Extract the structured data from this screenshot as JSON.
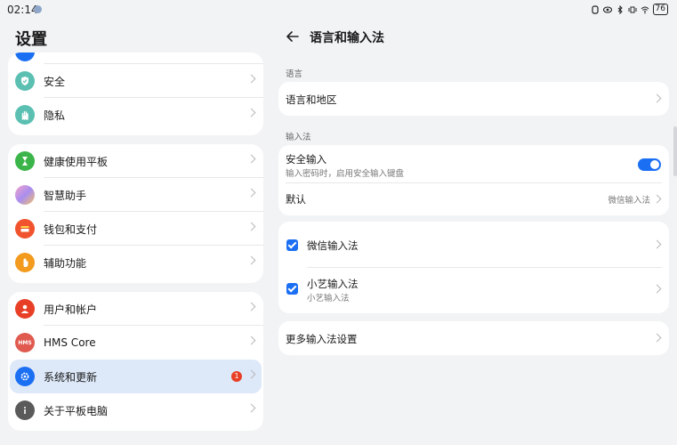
{
  "status_bar": {
    "time": "02:14",
    "battery": "76"
  },
  "left": {
    "title": "设置",
    "groups": [
      {
        "items": [
          {
            "label": "安全",
            "icon": "shield-icon",
            "color": "#5bbfb1"
          },
          {
            "label": "隐私",
            "icon": "privacy-hand-icon",
            "color": "#5bbfb1"
          }
        ]
      },
      {
        "items": [
          {
            "label": "健康使用平板",
            "icon": "hourglass-icon",
            "color": "#3bb54a"
          },
          {
            "label": "智慧助手",
            "icon": "assistant-orb-icon",
            "color": "#b48ae0"
          },
          {
            "label": "钱包和支付",
            "icon": "wallet-icon",
            "color": "#f0532d"
          },
          {
            "label": "辅助功能",
            "icon": "accessibility-hand-icon",
            "color": "#f29b1e"
          }
        ]
      },
      {
        "items": [
          {
            "label": "用户和帐户",
            "icon": "user-icon",
            "color": "#e84026"
          },
          {
            "label": "HMS Core",
            "icon": "hms-icon",
            "icon_text": "HMS",
            "color": "#e05a4f"
          },
          {
            "label": "系统和更新",
            "icon": "gear-icon",
            "color": "#1a6ff3",
            "selected": true,
            "badge": "1"
          },
          {
            "label": "关于平板电脑",
            "icon": "info-icon",
            "color": "#5a5a5a"
          }
        ]
      }
    ]
  },
  "right": {
    "title": "语言和输入法",
    "language_section": "语言",
    "language_item": "语言和地区",
    "input_section": "输入法",
    "secure_input": {
      "title": "安全输入",
      "subtitle": "输入密码时，启用安全输入键盘",
      "enabled": true
    },
    "default_input": {
      "title": "默认",
      "value": "微信输入法"
    },
    "methods": [
      {
        "title": "微信输入法",
        "subtitle": "",
        "checked": true
      },
      {
        "title": "小艺输入法",
        "subtitle": "小艺输入法",
        "checked": true
      }
    ],
    "more_settings": "更多输入法设置"
  },
  "colors": {
    "accent": "#1a6ff3",
    "background": "#f1f3f5",
    "card": "#ffffff",
    "selected_row": "#dde8f8",
    "badge": "#e84026"
  }
}
